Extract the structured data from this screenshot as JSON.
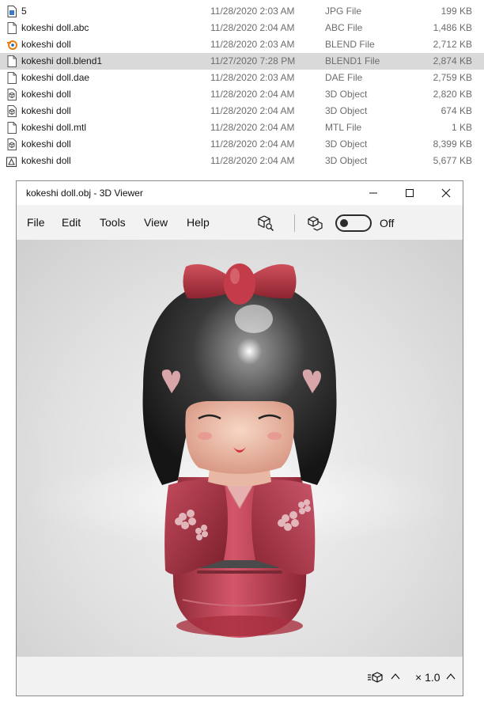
{
  "files": [
    {
      "name": "5",
      "date": "11/28/2020 2:03 AM",
      "type": "JPG File",
      "size": "199 KB",
      "icon": "image-file-icon",
      "selected": false
    },
    {
      "name": "kokeshi doll.abc",
      "date": "11/28/2020 2:04 AM",
      "type": "ABC File",
      "size": "1,486 KB",
      "icon": "generic-file-icon",
      "selected": false
    },
    {
      "name": "kokeshi doll",
      "date": "11/28/2020 2:03 AM",
      "type": "BLEND File",
      "size": "2,712 KB",
      "icon": "blender-icon",
      "selected": false
    },
    {
      "name": "kokeshi doll.blend1",
      "date": "11/27/2020 7:28 PM",
      "type": "BLEND1 File",
      "size": "2,874 KB",
      "icon": "generic-file-icon",
      "selected": true
    },
    {
      "name": "kokeshi doll.dae",
      "date": "11/28/2020 2:03 AM",
      "type": "DAE File",
      "size": "2,759 KB",
      "icon": "generic-file-icon",
      "selected": false
    },
    {
      "name": "kokeshi doll",
      "date": "11/28/2020 2:04 AM",
      "type": "3D Object",
      "size": "2,820 KB",
      "icon": "3d-object-icon",
      "selected": false
    },
    {
      "name": "kokeshi doll",
      "date": "11/28/2020 2:04 AM",
      "type": "3D Object",
      "size": "674 KB",
      "icon": "3d-object-icon",
      "selected": false
    },
    {
      "name": "kokeshi doll.mtl",
      "date": "11/28/2020 2:04 AM",
      "type": "MTL File",
      "size": "1 KB",
      "icon": "generic-file-icon",
      "selected": false
    },
    {
      "name": "kokeshi doll",
      "date": "11/28/2020 2:04 AM",
      "type": "3D Object",
      "size": "8,399 KB",
      "icon": "3d-object-icon",
      "selected": false
    },
    {
      "name": "kokeshi doll",
      "date": "11/28/2020 2:04 AM",
      "type": "3D Object",
      "size": "5,677 KB",
      "icon": "3d-model-icon",
      "selected": false
    }
  ],
  "viewer": {
    "title": "kokeshi doll.obj - 3D Viewer",
    "menu": [
      "File",
      "Edit",
      "Tools",
      "View",
      "Help"
    ],
    "toggle_label": "Off",
    "toggle_on": false,
    "zoom": "× 1.0",
    "icons": {
      "minimize": "minimize-icon",
      "maximize": "maximize-icon",
      "close": "close-icon",
      "object_tool": "cube-search-icon",
      "lighting_tool": "cubes-icon",
      "mode": "cube-mode-icon",
      "expand": "chevron-up-icon"
    },
    "colors": {
      "hair": "#2a2a2a",
      "kimono": "#b53a4a",
      "bow": "#b8323f",
      "face": "#f0c4ae",
      "background": "#e4e4e4"
    }
  }
}
